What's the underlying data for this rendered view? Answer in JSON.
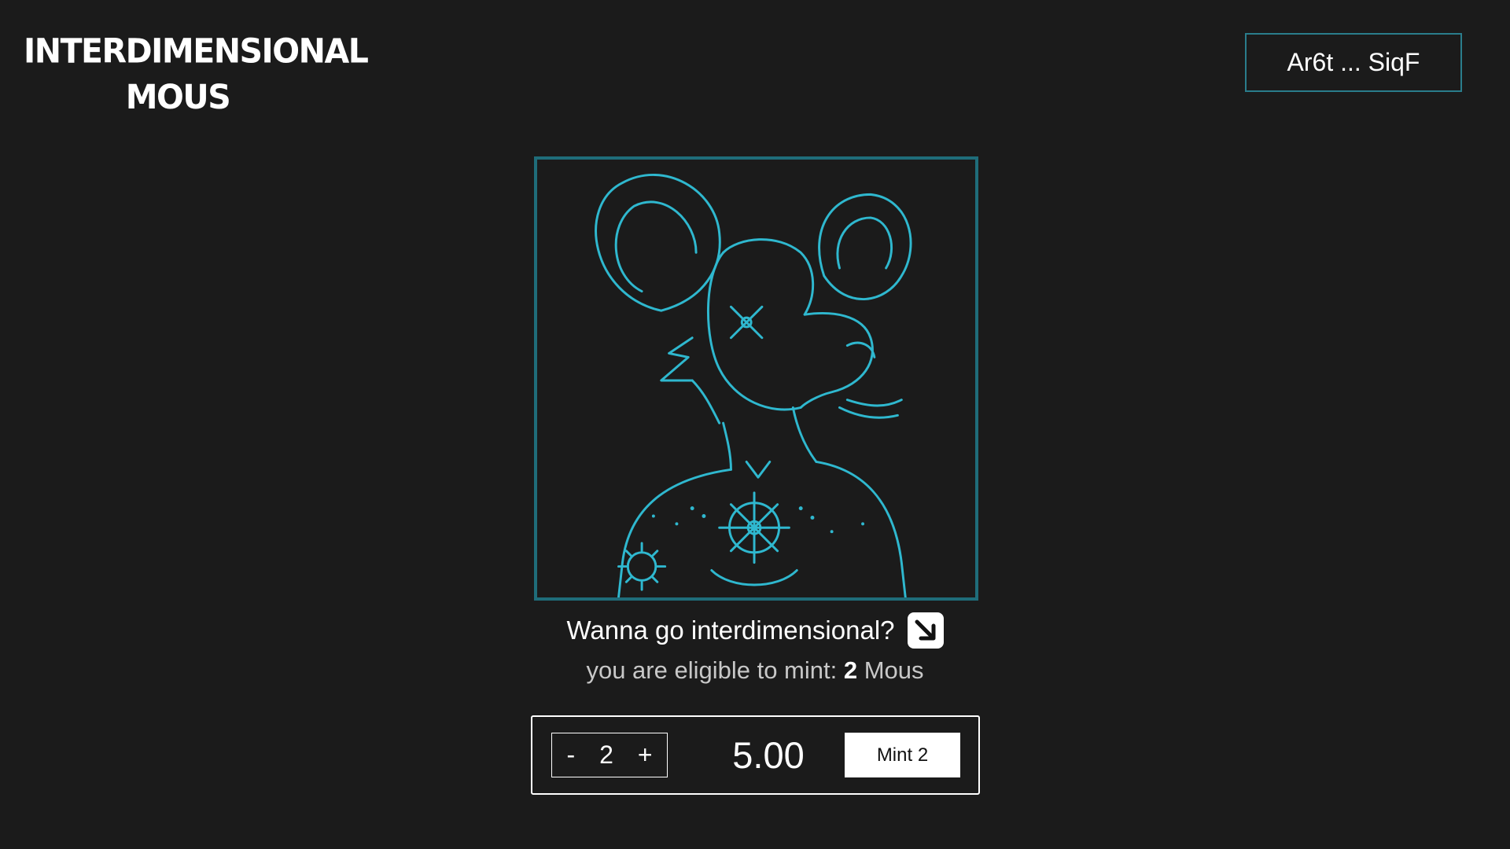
{
  "header": {
    "logo_line1": "INTERDIMENSIONAL",
    "logo_line2": "MOUS",
    "wallet_label": "Ar6t ... SiqF"
  },
  "hero": {
    "tagline": "Wanna go interdimensional?",
    "eligible_prefix": "you are eligible to mint:",
    "eligible_count": "2",
    "eligible_suffix": "Mous"
  },
  "mint": {
    "decrement_label": "-",
    "quantity": "2",
    "increment_label": "+",
    "price": "5.00",
    "mint_button_label": "Mint 2"
  },
  "colors": {
    "background": "#1b1b1b",
    "accent": "#1f6d7a",
    "art_line": "#2fb8cf"
  },
  "icons": {
    "tagline_icon": "arrow-down-right-icon"
  }
}
